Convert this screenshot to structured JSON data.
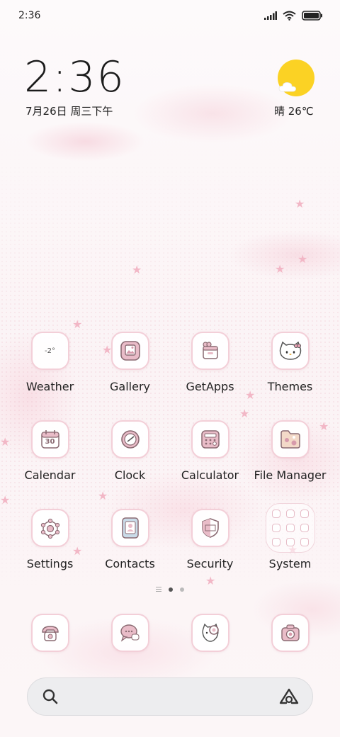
{
  "status_bar": {
    "time": "2:36"
  },
  "clock_widget": {
    "time": "2:36",
    "date": "7月26日 周三下午"
  },
  "weather_widget": {
    "condition_temp": "晴 26℃",
    "sun_color": "#fbd224"
  },
  "apps": [
    {
      "label": "Weather",
      "icon": "weather-icon",
      "icon_text": "-2°"
    },
    {
      "label": "Gallery",
      "icon": "gallery-icon"
    },
    {
      "label": "GetApps",
      "icon": "getapps-icon"
    },
    {
      "label": "Themes",
      "icon": "themes-icon"
    },
    {
      "label": "Calendar",
      "icon": "calendar-icon",
      "icon_text": "30"
    },
    {
      "label": "Clock",
      "icon": "clock-icon"
    },
    {
      "label": "Calculator",
      "icon": "calculator-icon"
    },
    {
      "label": "File Manager",
      "icon": "file-manager-icon"
    },
    {
      "label": "Settings",
      "icon": "settings-icon"
    },
    {
      "label": "Contacts",
      "icon": "contacts-icon"
    },
    {
      "label": "Security",
      "icon": "security-icon"
    },
    {
      "label": "System",
      "icon": "system-folder-icon"
    }
  ],
  "page_indicator": {
    "pages": 2,
    "active": 1
  },
  "dock": [
    {
      "icon": "phone-icon"
    },
    {
      "icon": "messages-icon"
    },
    {
      "icon": "browser-icon"
    },
    {
      "icon": "camera-icon"
    }
  ],
  "search": {
    "icon": "search-icon",
    "assistant_icon": "assistant-icon"
  },
  "colors": {
    "icon_border": "#f3cfd8",
    "accent_pink": "#e8a9b8",
    "icon_stroke": "#8a6a72"
  }
}
